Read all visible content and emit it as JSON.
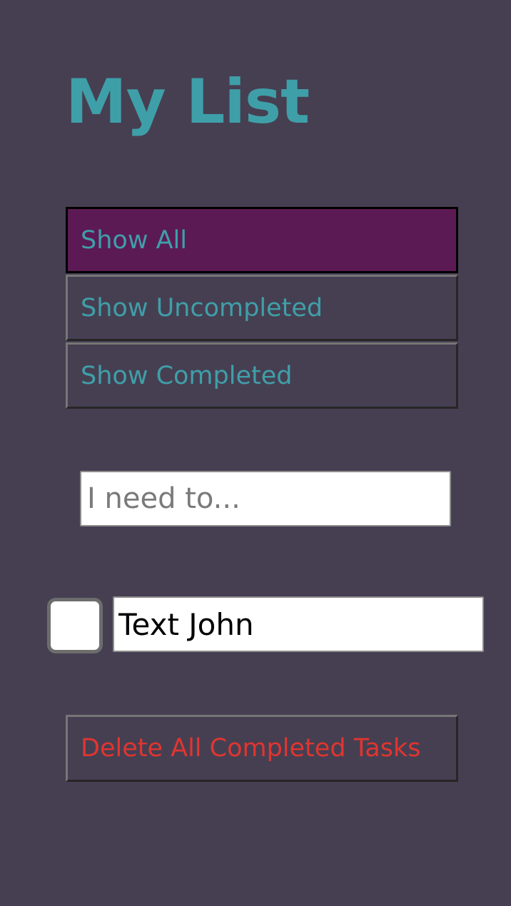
{
  "app": {
    "title": "My List"
  },
  "filters": {
    "items": [
      {
        "label": "Show All",
        "active": true
      },
      {
        "label": "Show Uncompleted",
        "active": false
      },
      {
        "label": "Show Completed",
        "active": false
      }
    ]
  },
  "new_task": {
    "placeholder": "I need to...",
    "value": ""
  },
  "tasks": [
    {
      "text": "Text John",
      "completed": false
    }
  ],
  "actions": {
    "delete_completed_label": "Delete All Completed Tasks"
  },
  "colors": {
    "background": "#463f52",
    "accent": "#3f9fa8",
    "active_filter": "#5c1a55",
    "danger": "#e0352f"
  }
}
